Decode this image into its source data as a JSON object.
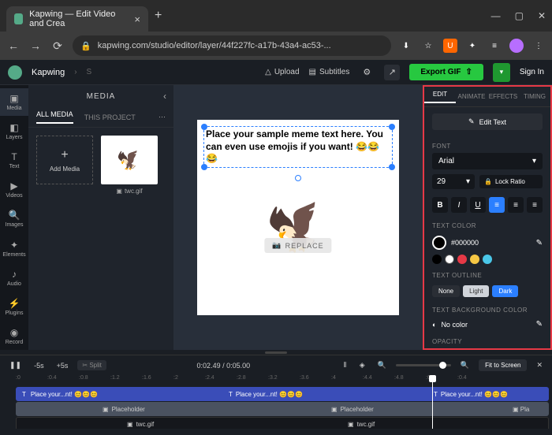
{
  "browser": {
    "tab_title": "Kapwing — Edit Video and Crea",
    "url": "kapwing.com/studio/editor/layer/44f227fc-a17b-43a4-ac53-..."
  },
  "header": {
    "app_name": "Kapwing",
    "upload": "Upload",
    "subtitles": "Subtitles",
    "export": "Export GIF",
    "signin": "Sign In"
  },
  "rail": {
    "items": [
      "Media",
      "Layers",
      "Text",
      "Videos",
      "Images",
      "Elements",
      "Audio",
      "Plugins",
      "Record"
    ]
  },
  "media": {
    "title": "MEDIA",
    "tabs": {
      "all": "ALL MEDIA",
      "project": "THIS PROJECT"
    },
    "add": "Add Media",
    "thumb_label": "twc.gif"
  },
  "canvas": {
    "text": "Place your sample meme text here. You can even use emojis if you want! 😂😂😂",
    "replace": "REPLACE"
  },
  "props": {
    "tabs": {
      "edit": "EDIT",
      "animate": "ANIMATE",
      "effects": "EFFECTS",
      "timing": "TIMING"
    },
    "edit_text": "Edit Text",
    "font_label": "FONT",
    "font": "Arial",
    "size": "29",
    "lock": "Lock Ratio",
    "text_color_label": "TEXT COLOR",
    "hex": "#000000",
    "swatches": [
      "#000000",
      "#ffffff",
      "#e63946",
      "#f6c744",
      "#4ac7e8"
    ],
    "outline_label": "TEXT OUTLINE",
    "outline": {
      "none": "None",
      "light": "Light",
      "dark": "Dark"
    },
    "bg_label": "TEXT BACKGROUND COLOR",
    "nocolor": "No color",
    "opacity_label": "OPACITY"
  },
  "timeline": {
    "minus5": "-5s",
    "plus5": "+5s",
    "split": "Split",
    "time": "0:02.49 / 0:05.00",
    "fit": "Fit to Screen",
    "ruler": [
      ":0",
      ":0.4",
      ":0.8",
      ":1.2",
      ":1.6",
      ":2",
      ":2.4",
      ":2.8",
      ":3.2",
      ":3.6",
      ":4",
      ":4.4",
      ":4.8",
      ":0",
      ":0.4"
    ],
    "text_track": "Place your...nt! 😊😊😊",
    "ph_track": "Placeholder",
    "gif_track": "twc.gif"
  }
}
